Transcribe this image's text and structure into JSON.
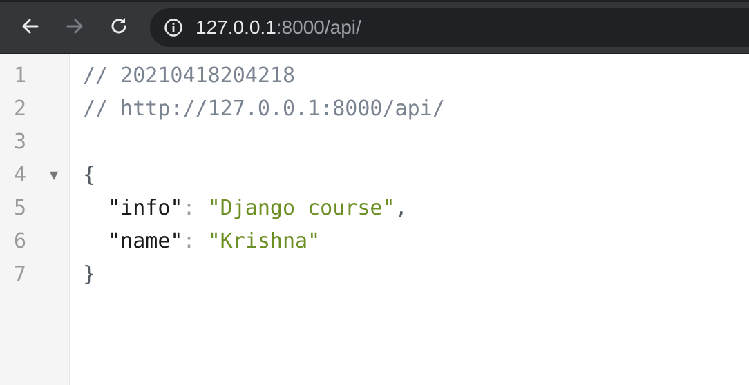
{
  "browser": {
    "nav": {
      "back_icon": "arrow-left-icon",
      "forward_icon": "arrow-right-icon",
      "reload_icon": "reload-icon"
    },
    "omnibox": {
      "info_icon": "info-icon",
      "url_host": "127.0.0.1",
      "url_rest": ":8000/api/"
    },
    "colors": {
      "toolbar": "#35363a",
      "omnibox": "#202124",
      "url_host": "#e8eaed",
      "url_rest": "#9aa0a6"
    }
  },
  "json_viewer": {
    "line_numbers": [
      "1",
      "2",
      "3",
      "4",
      "5",
      "6",
      "7"
    ],
    "fold_icon": "collapse-triangle-icon",
    "fold_glyph": "▼",
    "lines": {
      "comment_timestamp": "// 20210418204218",
      "comment_url": "// http://127.0.0.1:8000/api/",
      "open_brace": "{",
      "entries": [
        {
          "key": "\"info\"",
          "colon": ":",
          "value": "\"Django course\"",
          "comma": ","
        },
        {
          "key": "\"name\"",
          "colon": ":",
          "value": "\"Krishna\"",
          "comma": ""
        }
      ],
      "close_brace": "}"
    },
    "colors": {
      "comment": "#7a8390",
      "key": "#1a1a1a",
      "string": "#6b8f23",
      "gutter_bg": "#f5f5f5"
    }
  }
}
